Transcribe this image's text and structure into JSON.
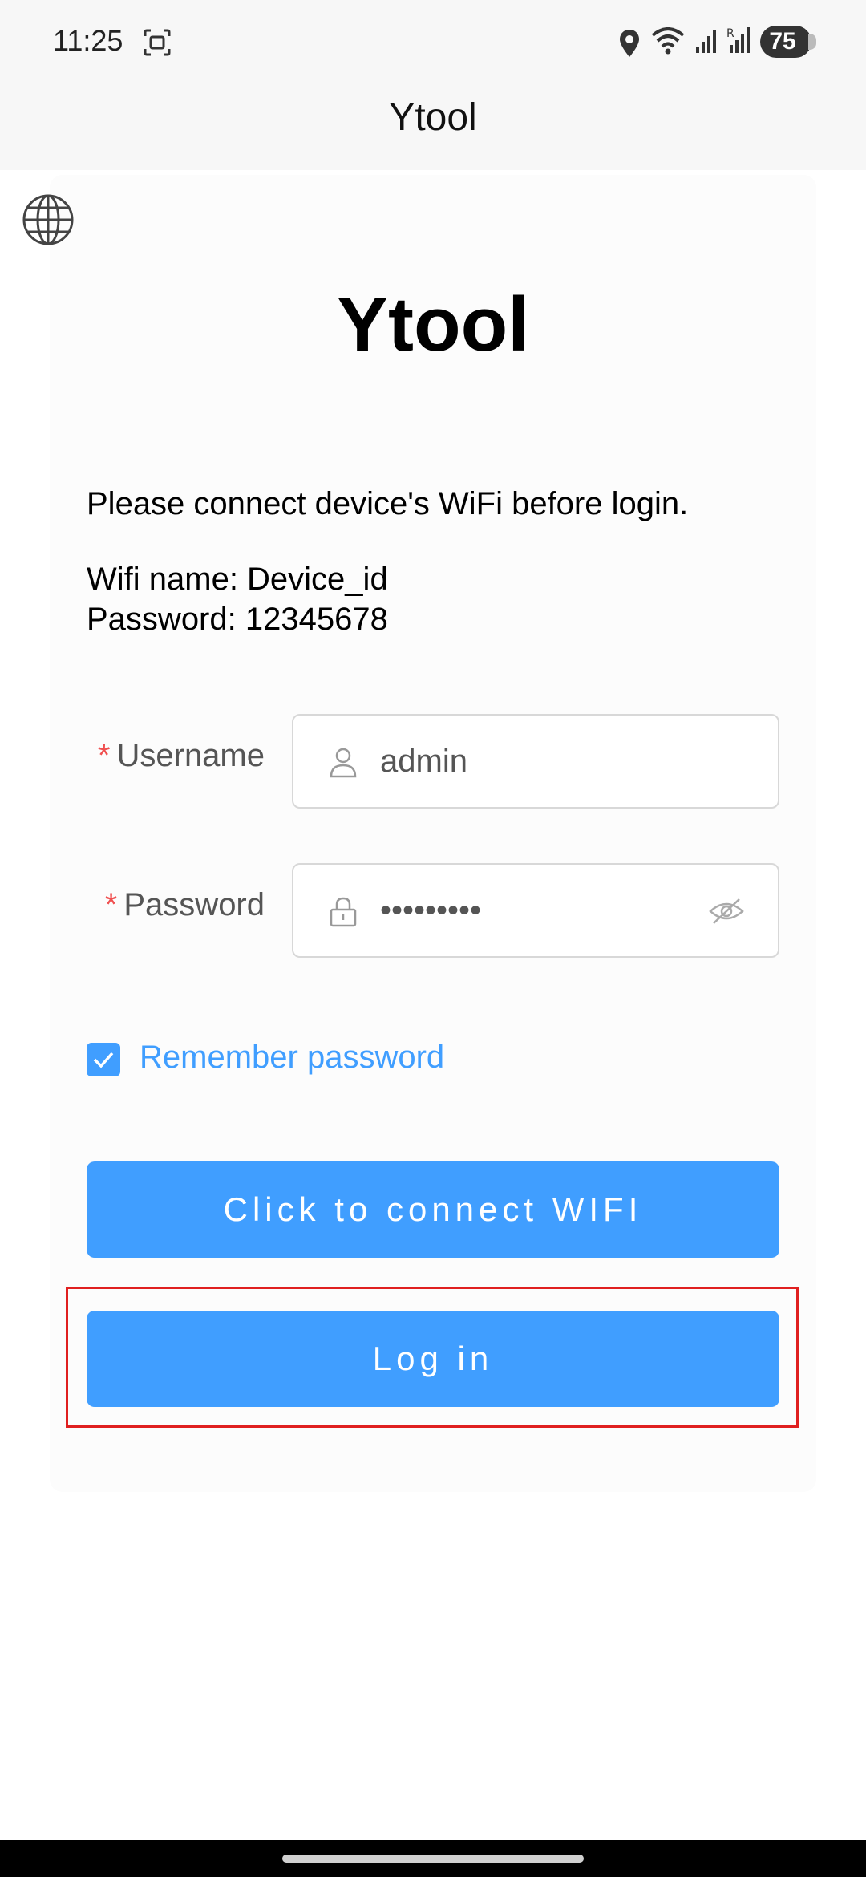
{
  "status_bar": {
    "time": "11:25",
    "battery": "75",
    "icons": [
      "screenshot-icon",
      "location-icon",
      "wifi-icon",
      "signal-icon",
      "signal-r-icon"
    ]
  },
  "app_bar": {
    "title": "Ytool"
  },
  "login": {
    "brand": "Ytool",
    "instruction": "Please connect device's WiFi before login.",
    "wifi_name": "Wifi name: Device_id",
    "wifi_password": "Password: 12345678",
    "username_label": "Username",
    "username_value": "admin",
    "password_label": "Password",
    "password_value": "•••••••••",
    "required_mark": "*",
    "remember_label": "Remember password",
    "remember_checked": true,
    "connect_button": "Click to connect WIFI",
    "login_button": "Log in"
  },
  "colors": {
    "accent": "#409eff",
    "required": "#f05050",
    "highlight": "#e02020"
  }
}
